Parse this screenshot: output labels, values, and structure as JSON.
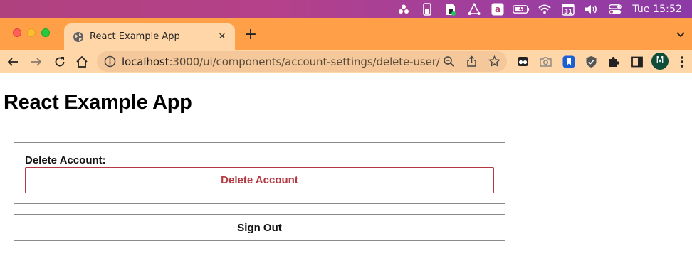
{
  "menubar": {
    "clock": "Tue 15:52",
    "calendar_day": "31",
    "icons": [
      "cluster-icon",
      "battery-phone-icon",
      "sim-icon",
      "vector-icon",
      "amazon-icon",
      "battery-icon",
      "wifi-icon",
      "calendar-icon",
      "volume-icon",
      "control-center-icon"
    ]
  },
  "browser": {
    "tab_title": "React Example App",
    "url_host": "localhost",
    "url_path": ":3000/ui/components/account-settings/delete-user/",
    "avatar_initial": "M",
    "colors": {
      "tab_strip": "#ff9f47",
      "toolbar": "#ffd6a8"
    }
  },
  "page": {
    "title": "React Example App",
    "delete_section_label": "Delete Account:",
    "delete_button_label": "Delete Account",
    "sign_out_label": "Sign Out",
    "colors": {
      "danger": "#b3383f"
    }
  }
}
